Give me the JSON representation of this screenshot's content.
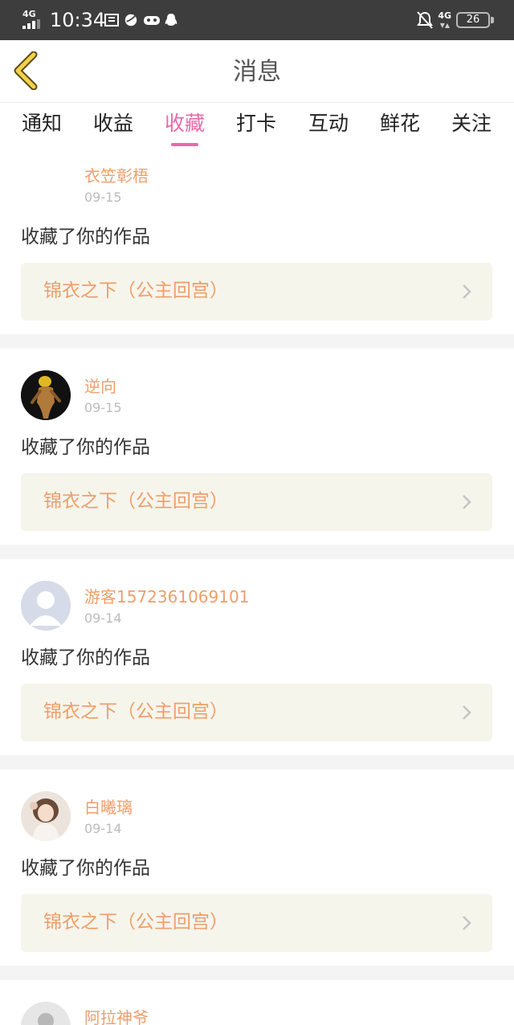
{
  "status_bar": {
    "network": "4G",
    "network_right": "4G",
    "time": "10:34",
    "battery": "26"
  },
  "header": {
    "title": "消息",
    "back_icon": "chevron-left-icon"
  },
  "tabs": [
    {
      "label": "通知",
      "active": false
    },
    {
      "label": "收益",
      "active": false
    },
    {
      "label": "收藏",
      "active": true
    },
    {
      "label": "打卡",
      "active": false
    },
    {
      "label": "互动",
      "active": false
    },
    {
      "label": "鲜花",
      "active": false
    },
    {
      "label": "关注",
      "active": false
    }
  ],
  "colors": {
    "accent_pink": "#e86aa8",
    "name_orange": "#ef9e6a",
    "work_box_bg": "#f6f5ec"
  },
  "messages": [
    {
      "user": "衣笠彰梧",
      "date": "09-15",
      "text": "收藏了你的作品",
      "work": "锦衣之下（公主回宫）",
      "avatar": "none"
    },
    {
      "user": "逆向",
      "date": "09-15",
      "text": "收藏了你的作品",
      "work": "锦衣之下（公主回宫）",
      "avatar": "figure-photo"
    },
    {
      "user": "游客1572361069101",
      "date": "09-14",
      "text": "收藏了你的作品",
      "work": "锦衣之下（公主回宫）",
      "avatar": "default-person"
    },
    {
      "user": "白曦璃",
      "date": "09-14",
      "text": "收藏了你的作品",
      "work": "锦衣之下（公主回宫）",
      "avatar": "girl-photo"
    },
    {
      "user": "阿拉神爷",
      "date": "",
      "text": "",
      "work": "",
      "avatar": "default-person"
    }
  ]
}
